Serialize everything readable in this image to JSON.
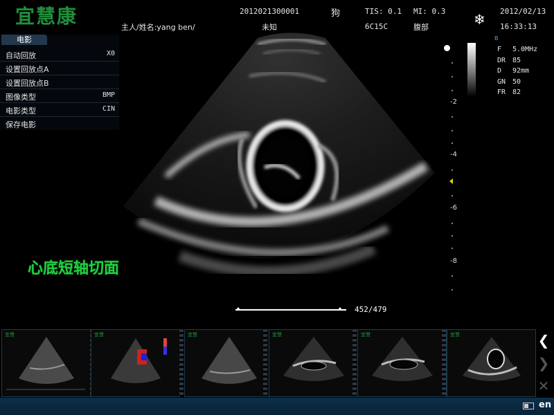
{
  "header": {
    "logo": "宜慧康",
    "patient_id": "2012021300001",
    "species": "狗",
    "tis": "TIS: 0.1",
    "mi": "MI: 0.3",
    "date": "2012/02/13",
    "owner_name": "主人/姓名:yang ben/",
    "gender": "未知",
    "probe": "6C15C",
    "exam": "腹部",
    "time": "16:33:13",
    "freeze_icon": "snowflake-icon"
  },
  "menu": {
    "title": "电影",
    "items": [
      {
        "label": "自动回放",
        "value": "X0"
      },
      {
        "label": "设置回放点A",
        "value": ""
      },
      {
        "label": "设置回放点B",
        "value": ""
      },
      {
        "label": "图像类型",
        "value": "BMP"
      },
      {
        "label": "电影类型",
        "value": "CIN"
      },
      {
        "label": "保存电影",
        "value": ""
      }
    ]
  },
  "params": {
    "mode": "B",
    "rows": [
      {
        "key": "F",
        "value": "5.0MHz"
      },
      {
        "key": "DR",
        "value": "85"
      },
      {
        "key": "D",
        "value": "92mm"
      },
      {
        "key": "GN",
        "value": "50"
      },
      {
        "key": "FR",
        "value": "82"
      }
    ]
  },
  "depth_scale": [
    "-2",
    "-4",
    "-6",
    "-8"
  ],
  "image_label": "心底短轴切面",
  "cine": {
    "frame": "452/479",
    "position": 0.944
  },
  "thumbnails": [
    {
      "type": "liver",
      "selected": false
    },
    {
      "type": "color-doppler",
      "selected": false
    },
    {
      "type": "liver",
      "selected": false
    },
    {
      "type": "cardiac-long",
      "selected": false
    },
    {
      "type": "cardiac-long",
      "selected": false
    },
    {
      "type": "cardiac-short",
      "selected": true
    }
  ],
  "nav": {
    "prev_icon": "chevron-left-icon",
    "next_icon": "chevron-right-icon",
    "delete_icon": "close-icon"
  },
  "status": {
    "battery_icon": "battery-icon",
    "language": "en"
  },
  "colors": {
    "logo": "#1f8f3a",
    "label_green": "#1fd23f",
    "status_bar": "#0c2f48",
    "focus_marker": "#e8d000"
  }
}
